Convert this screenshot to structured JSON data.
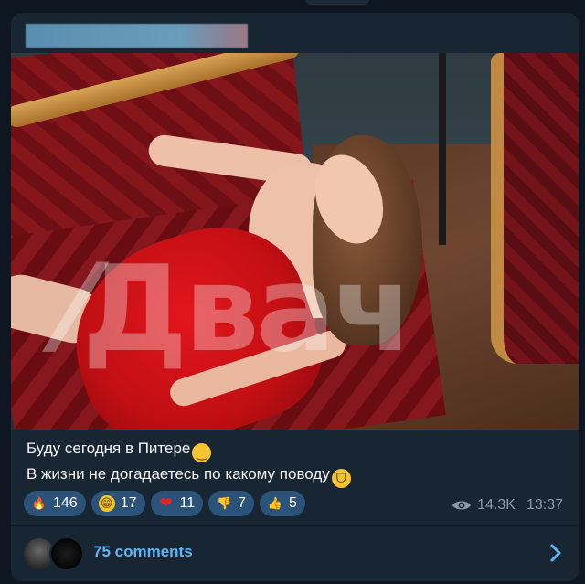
{
  "post": {
    "text_line1": "Буду сегодня в Питере",
    "text_line2": "В жизни не догадаетесь по какому поводу",
    "watermark": "Двач",
    "views": "14.3K",
    "time": "13:37"
  },
  "reactions": [
    {
      "icon": "fire-emoji",
      "glyph": "🔥",
      "count": "146"
    },
    {
      "icon": "grin-emoji",
      "glyph": "😁",
      "count": "17"
    },
    {
      "icon": "heart-emoji",
      "glyph": "❤",
      "count": "11"
    },
    {
      "icon": "thumbs-down-emoji",
      "glyph": "👎",
      "count": "7"
    },
    {
      "icon": "thumbs-up-emoji",
      "glyph": "👍",
      "count": "5"
    }
  ],
  "comments": {
    "label": "75 comments"
  },
  "colors": {
    "background": "#0e1621",
    "bubble": "#182533",
    "reaction_pill": "#2b5278",
    "link": "#5eb5f7",
    "meta": "#8b9aa8"
  }
}
